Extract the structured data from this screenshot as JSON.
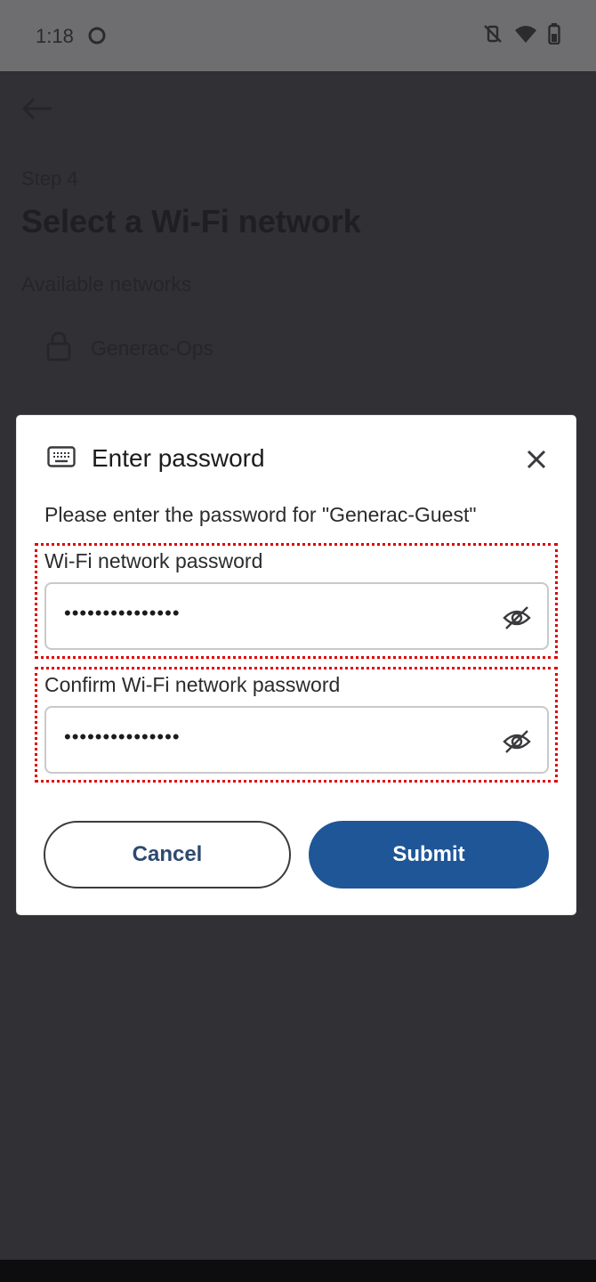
{
  "status_bar": {
    "time": "1:18",
    "icons": [
      "sync-icon",
      "vibrate-off-icon",
      "wifi-icon",
      "battery-icon"
    ]
  },
  "background": {
    "step": "Step 4",
    "title": "Select a Wi-Fi network",
    "section_label": "Available networks",
    "networks": [
      {
        "name": "Generac-Ops",
        "icon": "lock-icon"
      }
    ]
  },
  "dialog": {
    "icon": "keyboard-icon",
    "title": "Enter password",
    "message": "Please enter the password for \"Generac-Guest\"",
    "fields": [
      {
        "label": "Wi-Fi network password",
        "value": "•••••••••••••••",
        "toggle_icon": "eye-off-icon"
      },
      {
        "label": "Confirm Wi-Fi network password",
        "value": "•••••••••••••••",
        "toggle_icon": "eye-off-icon"
      }
    ],
    "cancel_label": "Cancel",
    "submit_label": "Submit"
  },
  "colors": {
    "accent": "#1e5697",
    "highlight": "#e00000",
    "scrim": "#303035"
  }
}
